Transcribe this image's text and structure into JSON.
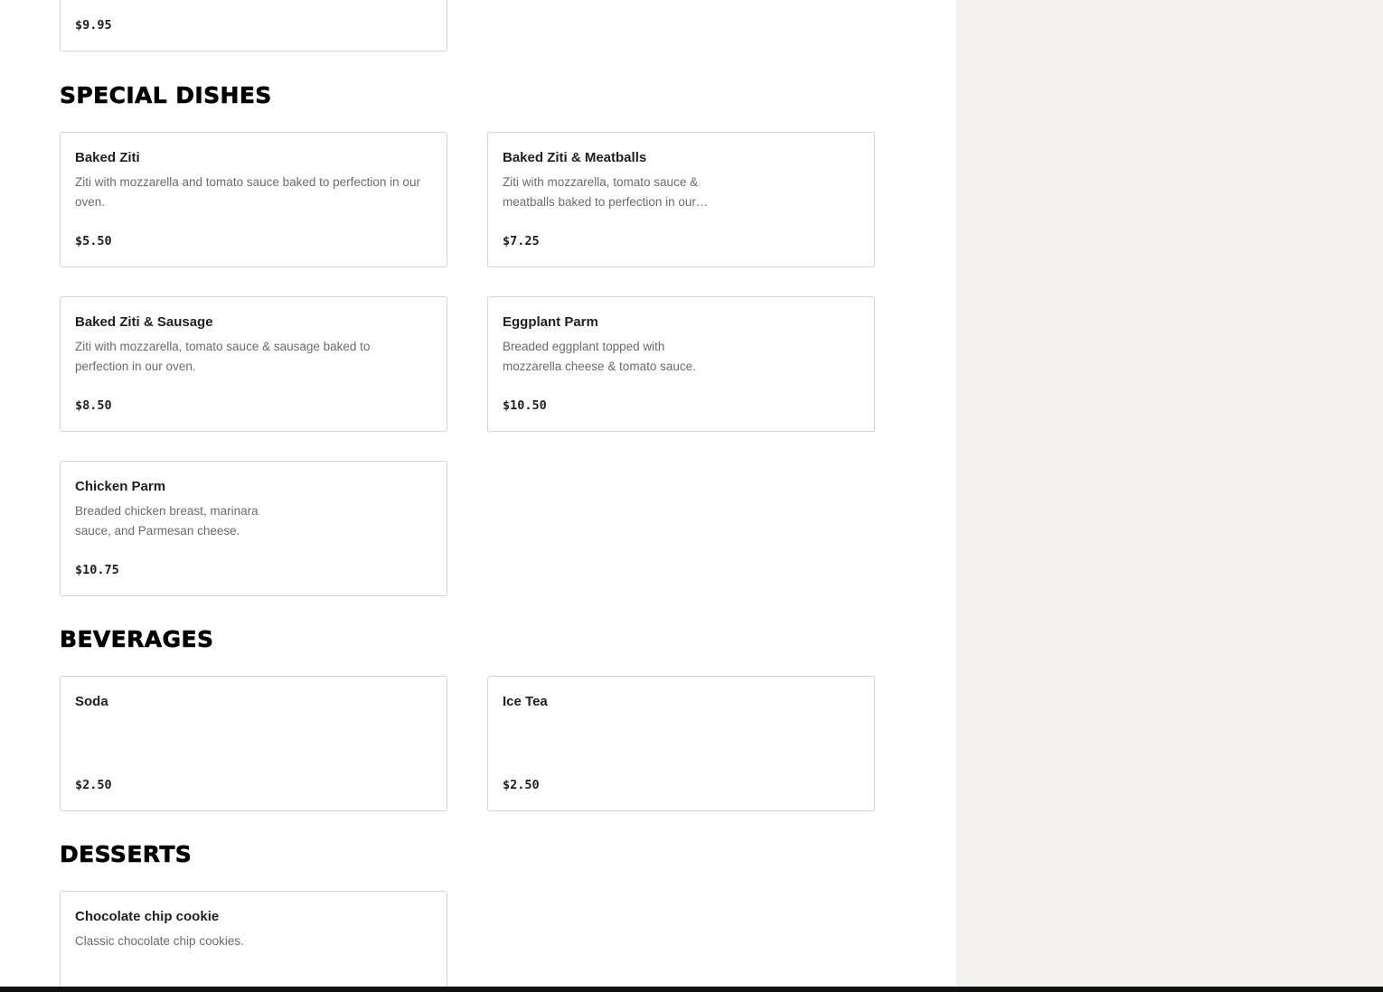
{
  "sections": [
    {
      "items": [
        {
          "price": "$9.95"
        }
      ]
    },
    {
      "title": "SPECIAL DISHES",
      "items": [
        {
          "name": "Baked Ziti",
          "description": "Ziti with mozzarella and tomato sauce baked to perfection in our oven.",
          "price": "$5.50"
        },
        {
          "name": "Baked Ziti & Meatballs",
          "description": "Ziti with mozzarella, tomato sauce & meatballs baked to perfection in our oven.",
          "price": "$7.25"
        },
        {
          "name": "Baked Ziti & Sausage",
          "description": "Ziti with mozzarella, tomato sauce & sausage baked to perfection in our oven.",
          "price": "$8.50"
        },
        {
          "name": "Eggplant Parm",
          "description": "Breaded eggplant topped with mozzarella cheese & tomato sauce.",
          "price": "$10.50"
        },
        {
          "name": "Chicken Parm",
          "description": "Breaded chicken breast, marinara sauce, and Parmesan cheese.",
          "price": "$10.75"
        }
      ]
    },
    {
      "title": "BEVERAGES",
      "items": [
        {
          "name": "Soda",
          "description": "",
          "price": "$2.50"
        },
        {
          "name": "Ice Tea",
          "description": "",
          "price": "$2.50"
        }
      ]
    },
    {
      "title": "DESSERTS",
      "items": [
        {
          "name": "Chocolate chip cookie",
          "description": "Classic chocolate chip cookies."
        }
      ]
    }
  ]
}
